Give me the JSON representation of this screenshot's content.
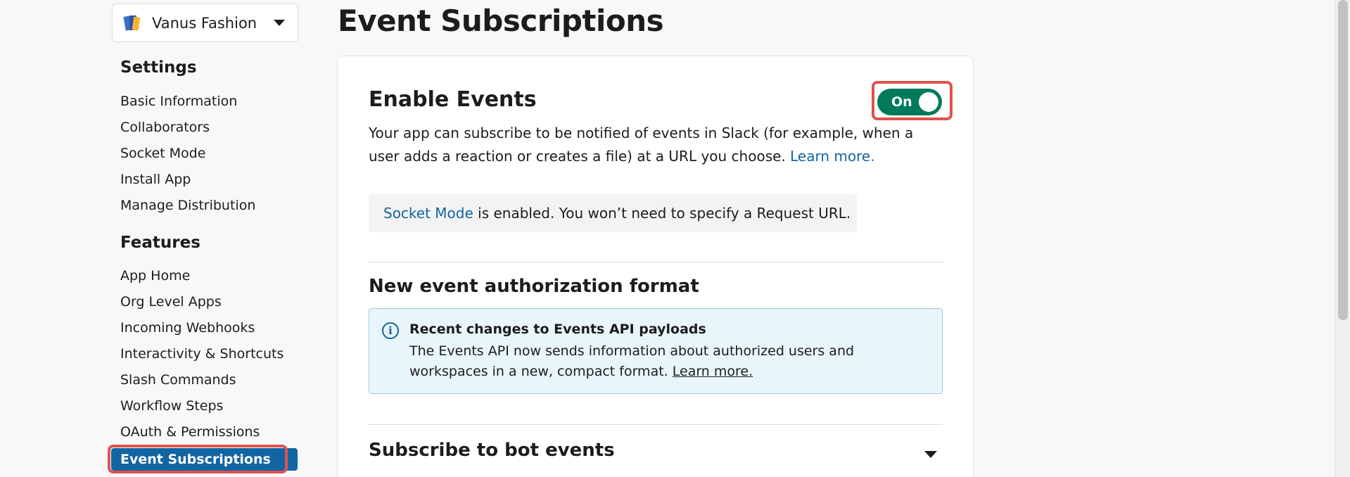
{
  "app_switcher": {
    "name": "Vanus Fashion"
  },
  "sidebar": {
    "settings_title": "Settings",
    "settings_items": [
      {
        "label": "Basic Information"
      },
      {
        "label": "Collaborators"
      },
      {
        "label": "Socket Mode"
      },
      {
        "label": "Install App"
      },
      {
        "label": "Manage Distribution"
      }
    ],
    "features_title": "Features",
    "features_items": [
      {
        "label": "App Home"
      },
      {
        "label": "Org Level Apps"
      },
      {
        "label": "Incoming Webhooks"
      },
      {
        "label": "Interactivity & Shortcuts"
      },
      {
        "label": "Slash Commands"
      },
      {
        "label": "Workflow Steps"
      },
      {
        "label": "OAuth & Permissions"
      }
    ],
    "active_item": "Event Subscriptions"
  },
  "main": {
    "page_title": "Event Subscriptions",
    "enable_events": {
      "heading": "Enable Events",
      "toggle_label": "On",
      "description": "Your app can subscribe to be notified of events in Slack (for example, when a user adds a reaction or creates a file) at a URL you choose.",
      "learn_more": "Learn more."
    },
    "socket_note": {
      "link": "Socket Mode",
      "text": " is enabled. You won’t need to specify a Request URL."
    },
    "auth_format": {
      "heading": "New event authorization format",
      "info_title": "Recent changes to Events API payloads",
      "info_body": "The Events API now sends information about authorized users and workspaces in a new, compact format.",
      "info_link": "Learn more."
    },
    "bot_events": {
      "heading": "Subscribe to bot events"
    }
  },
  "colors": {
    "accent": "#1264a3",
    "toggle_on": "#007a5a",
    "highlight": "#e0524f",
    "info_bg": "#e8f5fa"
  }
}
